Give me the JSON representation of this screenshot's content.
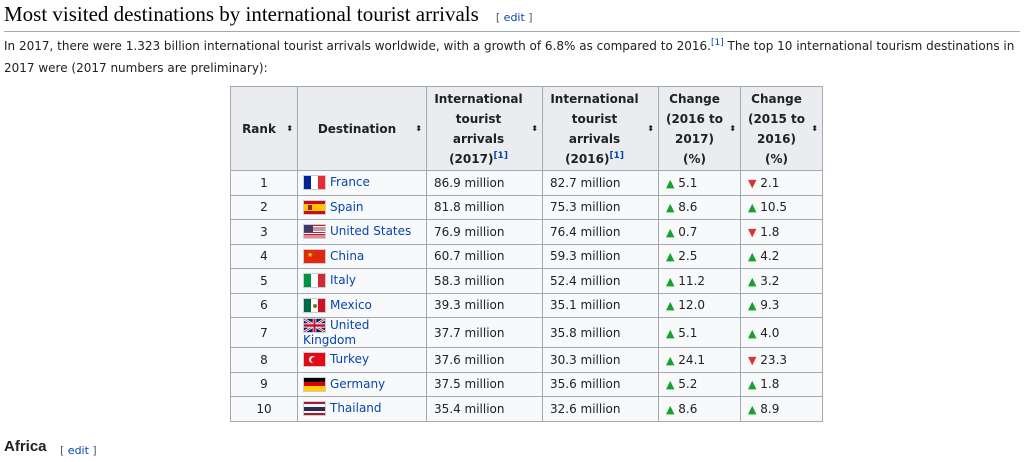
{
  "section": {
    "title": "Most visited destinations by international tourist arrivals",
    "edit_open": "[ ",
    "edit_label": "edit",
    "edit_close": " ]"
  },
  "intro": {
    "text_before_ref": "In 2017, there were 1.323 billion international tourist arrivals worldwide, with a growth of 6.8% as compared to 2016.",
    "ref": "[1]",
    "text_after_ref": " The top 10 international tourism destinations in 2017 were (2017 numbers are preliminary):"
  },
  "table": {
    "headers": {
      "rank": "Rank",
      "destination": "Destination",
      "arrivals_2017_l1": "International",
      "arrivals_2017_l2": "tourist",
      "arrivals_2017_l3": "arrivals",
      "arrivals_2017_l4": "(2017)",
      "arrivals_2017_ref": "[1]",
      "arrivals_2016_l1": "International",
      "arrivals_2016_l2": "tourist",
      "arrivals_2016_l3": "arrivals",
      "arrivals_2016_l4": "(2016)",
      "arrivals_2016_ref": "[1]",
      "change_1716_l1": "Change",
      "change_1716_l2": "(2016 to",
      "change_1716_l3": "2017)",
      "change_1716_l4": "(%)",
      "change_1615_l1": "Change",
      "change_1615_l2": "(2015 to",
      "change_1615_l3": "2016)",
      "change_1615_l4": "(%)"
    },
    "sort_icon": "⬍",
    "arrow_up": "▲",
    "arrow_down": "▼",
    "rows": [
      {
        "rank": "1",
        "country": "France",
        "flag": "france-flag",
        "a2017": "86.9 million",
        "a2016": "82.7 million",
        "c1": "5.1",
        "c1_dir": "up",
        "c2": "2.1",
        "c2_dir": "down"
      },
      {
        "rank": "2",
        "country": "Spain",
        "flag": "spain-flag",
        "a2017": "81.8 million",
        "a2016": "75.3 million",
        "c1": "8.6",
        "c1_dir": "up",
        "c2": "10.5",
        "c2_dir": "up"
      },
      {
        "rank": "3",
        "country": "United States",
        "flag": "usa-flag",
        "a2017": "76.9 million",
        "a2016": "76.4 million",
        "c1": "0.7",
        "c1_dir": "up",
        "c2": "1.8",
        "c2_dir": "down"
      },
      {
        "rank": "4",
        "country": "China",
        "flag": "china-flag",
        "a2017": "60.7 million",
        "a2016": "59.3 million",
        "c1": "2.5",
        "c1_dir": "up",
        "c2": "4.2",
        "c2_dir": "up"
      },
      {
        "rank": "5",
        "country": "Italy",
        "flag": "italy-flag",
        "a2017": "58.3 million",
        "a2016": "52.4 million",
        "c1": "11.2",
        "c1_dir": "up",
        "c2": "3.2",
        "c2_dir": "up"
      },
      {
        "rank": "6",
        "country": "Mexico",
        "flag": "mexico-flag",
        "a2017": "39.3 million",
        "a2016": "35.1 million",
        "c1": "12.0",
        "c1_dir": "up",
        "c2": "9.3",
        "c2_dir": "up"
      },
      {
        "rank": "7",
        "country": "United Kingdom",
        "flag": "uk-flag",
        "a2017": "37.7 million",
        "a2016": "35.8 million",
        "c1": "5.1",
        "c1_dir": "up",
        "c2": "4.0",
        "c2_dir": "up"
      },
      {
        "rank": "8",
        "country": "Turkey",
        "flag": "turkey-flag",
        "a2017": "37.6 million",
        "a2016": "30.3 million",
        "c1": "24.1",
        "c1_dir": "up",
        "c2": "23.3",
        "c2_dir": "down"
      },
      {
        "rank": "9",
        "country": "Germany",
        "flag": "germany-flag",
        "a2017": "37.5 million",
        "a2016": "35.6 million",
        "c1": "5.2",
        "c1_dir": "up",
        "c2": "1.8",
        "c2_dir": "up"
      },
      {
        "rank": "10",
        "country": "Thailand",
        "flag": "thailand-flag",
        "a2017": "35.4 million",
        "a2016": "32.6 million",
        "c1": "8.6",
        "c1_dir": "up",
        "c2": "8.9",
        "c2_dir": "up"
      }
    ]
  },
  "next_section": {
    "title": "Africa",
    "edit_open": "[ ",
    "edit_label": "edit",
    "edit_close": " ]"
  },
  "colors": {
    "link": "#0645ad",
    "increase": "#14a12c",
    "decrease": "#dd3333",
    "header_bg": "#eaecf0",
    "cell_bg": "#f8f9fa",
    "border": "#a2a9b1"
  }
}
